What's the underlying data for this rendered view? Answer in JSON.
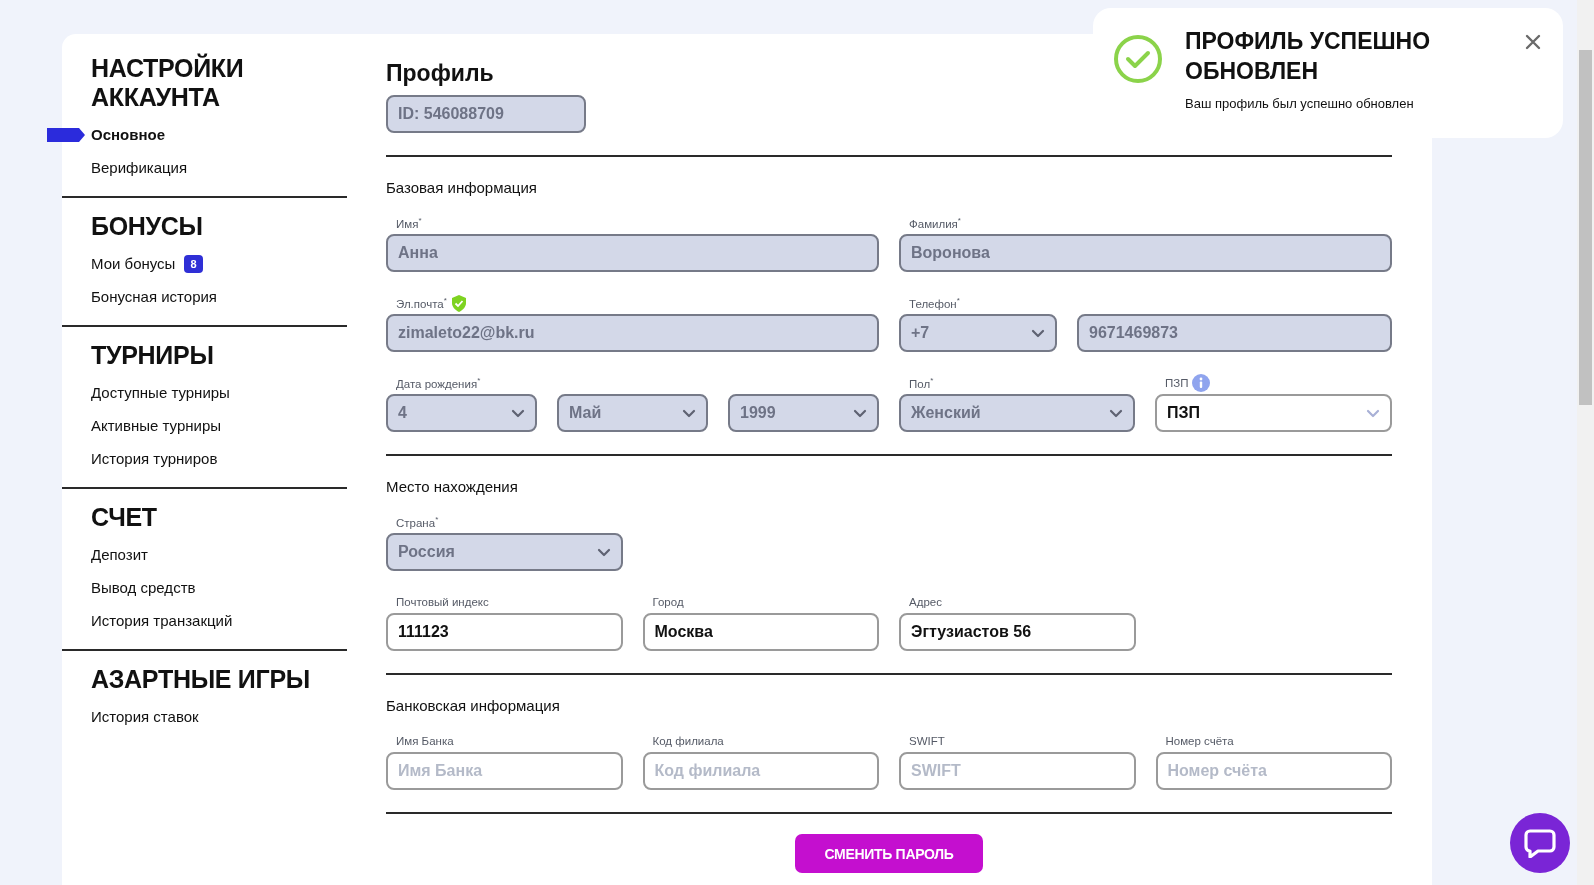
{
  "sidebar": {
    "sections": [
      {
        "title": "НАСТРОЙКИ АККАУНТА",
        "items": [
          {
            "label": "Основное",
            "selected": true
          },
          {
            "label": "Верификация",
            "selected": false
          }
        ]
      },
      {
        "title": "БОНУСЫ",
        "items": [
          {
            "label": "Мои бонусы",
            "selected": false,
            "badge": "8"
          },
          {
            "label": "Бонусная история",
            "selected": false
          }
        ]
      },
      {
        "title": "ТУРНИРЫ",
        "items": [
          {
            "label": "Доступные турниры",
            "selected": false
          },
          {
            "label": "Активные турниры",
            "selected": false
          },
          {
            "label": "История турниров",
            "selected": false
          }
        ]
      },
      {
        "title": "СЧЕТ",
        "items": [
          {
            "label": "Депозит",
            "selected": false
          },
          {
            "label": "Вывод средств",
            "selected": false
          },
          {
            "label": "История транзакций",
            "selected": false
          }
        ]
      },
      {
        "title": "АЗАРТНЫЕ ИГРЫ",
        "items": [
          {
            "label": "История ставок",
            "selected": false
          }
        ]
      }
    ]
  },
  "profile": {
    "title": "Профиль",
    "id_field": {
      "value": "ID: 546088709",
      "disabled": true
    },
    "sections": [
      {
        "title": "Базовая информация",
        "rows": [
          {
            "kind": "halves",
            "fields": [
              {
                "kind": "input",
                "label": "Имя$^{*}$",
                "value": "Анна",
                "disabled": true
              },
              {
                "kind": "input",
                "label": "Фамилия$^{*}$",
                "value": "Воронова",
                "disabled": true
              }
            ]
          },
          {
            "kind": "contact",
            "fields": [
              {
                "kind": "input",
                "label": "Эл.почта$^{*}$",
                "value": "zimaleto22@bk.ru",
                "disabled": true,
                "verified": true
              },
              {
                "kind": "select",
                "label": "Телефон$^{*}$",
                "value": "+7",
                "disabled": true
              },
              {
                "kind": "input",
                "value": "9671469873",
                "disabled": true
              }
            ]
          },
          {
            "kind": "birthdate",
            "fields": [
              {
                "kind": "select",
                "label": "Дата рождения$^{*}$",
                "value": "4",
                "disabled": true
              },
              {
                "kind": "select",
                "value": "Май",
                "disabled": true
              },
              {
                "kind": "select",
                "value": "1999",
                "disabled": true
              },
              {
                "kind": "select",
                "label": "Пол$^{*}$",
                "value": "Женский",
                "disabled": true
              },
              {
                "kind": "select",
                "label": "ПЗП",
                "value": "ПЗП",
                "disabled": false,
                "info": true
              }
            ]
          }
        ]
      },
      {
        "title": "Место нахождения",
        "rows": [
          {
            "kind": "quarters",
            "fields": [
              {
                "kind": "select",
                "label": "Страна$^{*}$",
                "value": "Россия",
                "disabled": true
              }
            ]
          },
          {
            "kind": "quarters",
            "fields": [
              {
                "kind": "input",
                "label": "Почтовый индекс",
                "value": "111123",
                "disabled": false
              },
              {
                "kind": "input",
                "label": "Город",
                "value": "Москва",
                "disabled": false
              },
              {
                "kind": "input",
                "label": "Адрес",
                "value": "Эгтузиастов 56",
                "disabled": false
              }
            ]
          }
        ]
      },
      {
        "title": "Банковская информация",
        "rows": [
          {
            "kind": "quarters",
            "fields": [
              {
                "kind": "input",
                "label": "Имя Банка",
                "placeholder": "Имя Банка",
                "disabled": false
              },
              {
                "kind": "input",
                "label": "Код филиала",
                "placeholder": "Код филиала",
                "disabled": false
              },
              {
                "kind": "input",
                "label": "SWIFT",
                "placeholder": "SWIFT",
                "disabled": false
              },
              {
                "kind": "input",
                "label": "Номер счёта",
                "placeholder": "Номер счёта",
                "disabled": false
              }
            ]
          }
        ]
      }
    ],
    "button": "СМЕНИТЬ ПАРОЛЬ"
  },
  "toast": {
    "title": "ПРОФИЛЬ УСПЕШНО ОБНОВЛЕН",
    "message": "Ваш профиль был успешно обновлен"
  }
}
